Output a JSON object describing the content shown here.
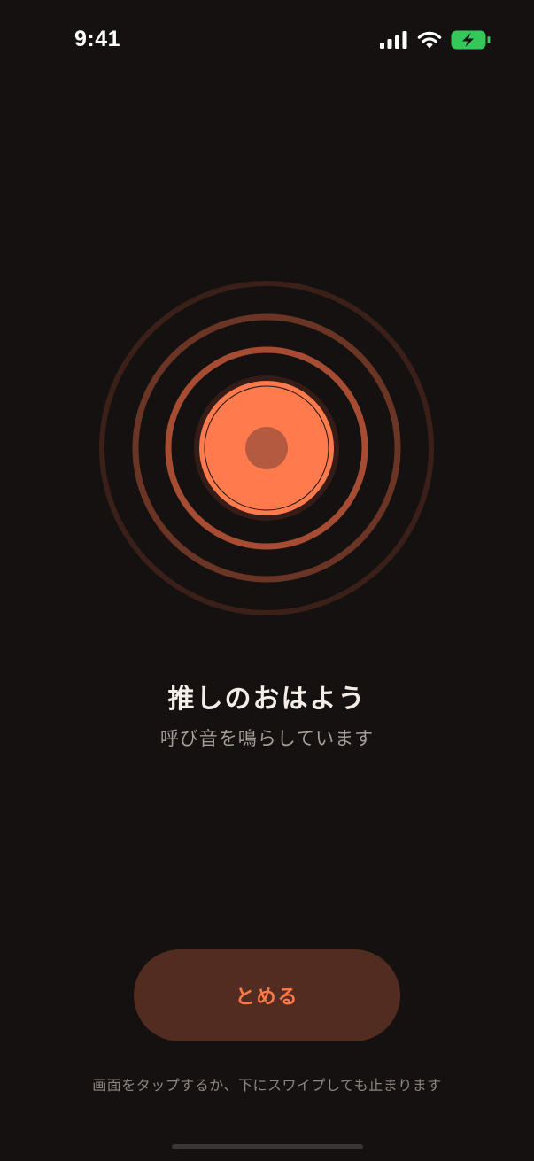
{
  "status_bar": {
    "time": "9:41",
    "icons": [
      "signal-icon",
      "wifi-icon",
      "battery-charging-icon"
    ],
    "battery_color": "#34c759"
  },
  "alarm": {
    "title": "推しのおはよう",
    "subtitle": "呼び音を鳴らしています"
  },
  "stop_button": {
    "label": "とめる"
  },
  "hint": "画面をタップするか、下にスワイプしても止まります",
  "colors": {
    "background": "#151110",
    "accent": "#ff7a4a",
    "button_bg": "#522b21"
  }
}
